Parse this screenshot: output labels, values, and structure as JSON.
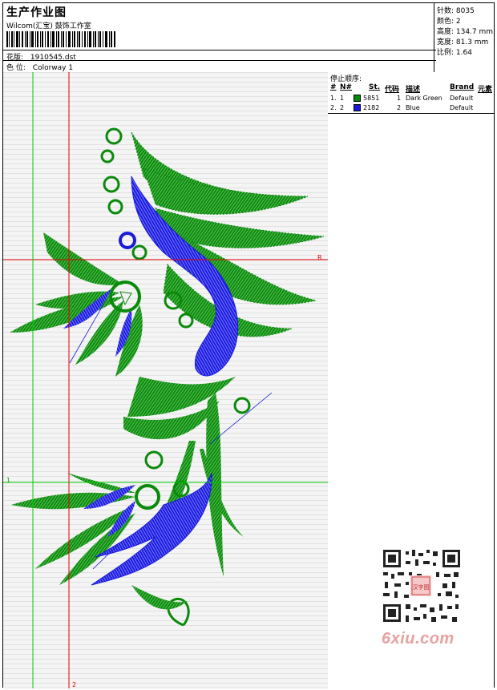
{
  "header": {
    "title": "生产作业图",
    "company": "Wilcom(汇宝) 鼓饰工作室",
    "design_label": "花版:",
    "design_value": "1910545.dst",
    "colorway_label": "色 位:",
    "colorway_value": "Colorway 1"
  },
  "stats": {
    "stitches": "针数: 8035",
    "colors": "颜色: 2",
    "height": "高度: 134.7 mm",
    "width": "宽度: 81.3 mm",
    "scale": "比例: 1.64"
  },
  "sequence": {
    "title": "停止顺序:",
    "headers": [
      "#",
      "N#",
      "St.",
      "代码",
      "描述",
      "Brand",
      "元素"
    ],
    "rows": [
      {
        "idx": "1.",
        "num": "1",
        "stitch": "5851",
        "code": "1",
        "desc": "Dark Green",
        "brand": "Default",
        "color": "#0a8a0a"
      },
      {
        "idx": "2.",
        "num": "2",
        "stitch": "2182",
        "code": "2",
        "desc": "Blue",
        "brand": "Default",
        "color": "#1a1adc"
      }
    ]
  },
  "markers": {
    "r": "R",
    "one": "1",
    "two": "2"
  },
  "watermark": {
    "text": "6xiu.com",
    "stamp": "汉字图"
  },
  "colors": {
    "green": "#0a8a0a",
    "blue": "#1a1adc",
    "guide_red": "#e00000",
    "guide_green": "#00cc00"
  }
}
